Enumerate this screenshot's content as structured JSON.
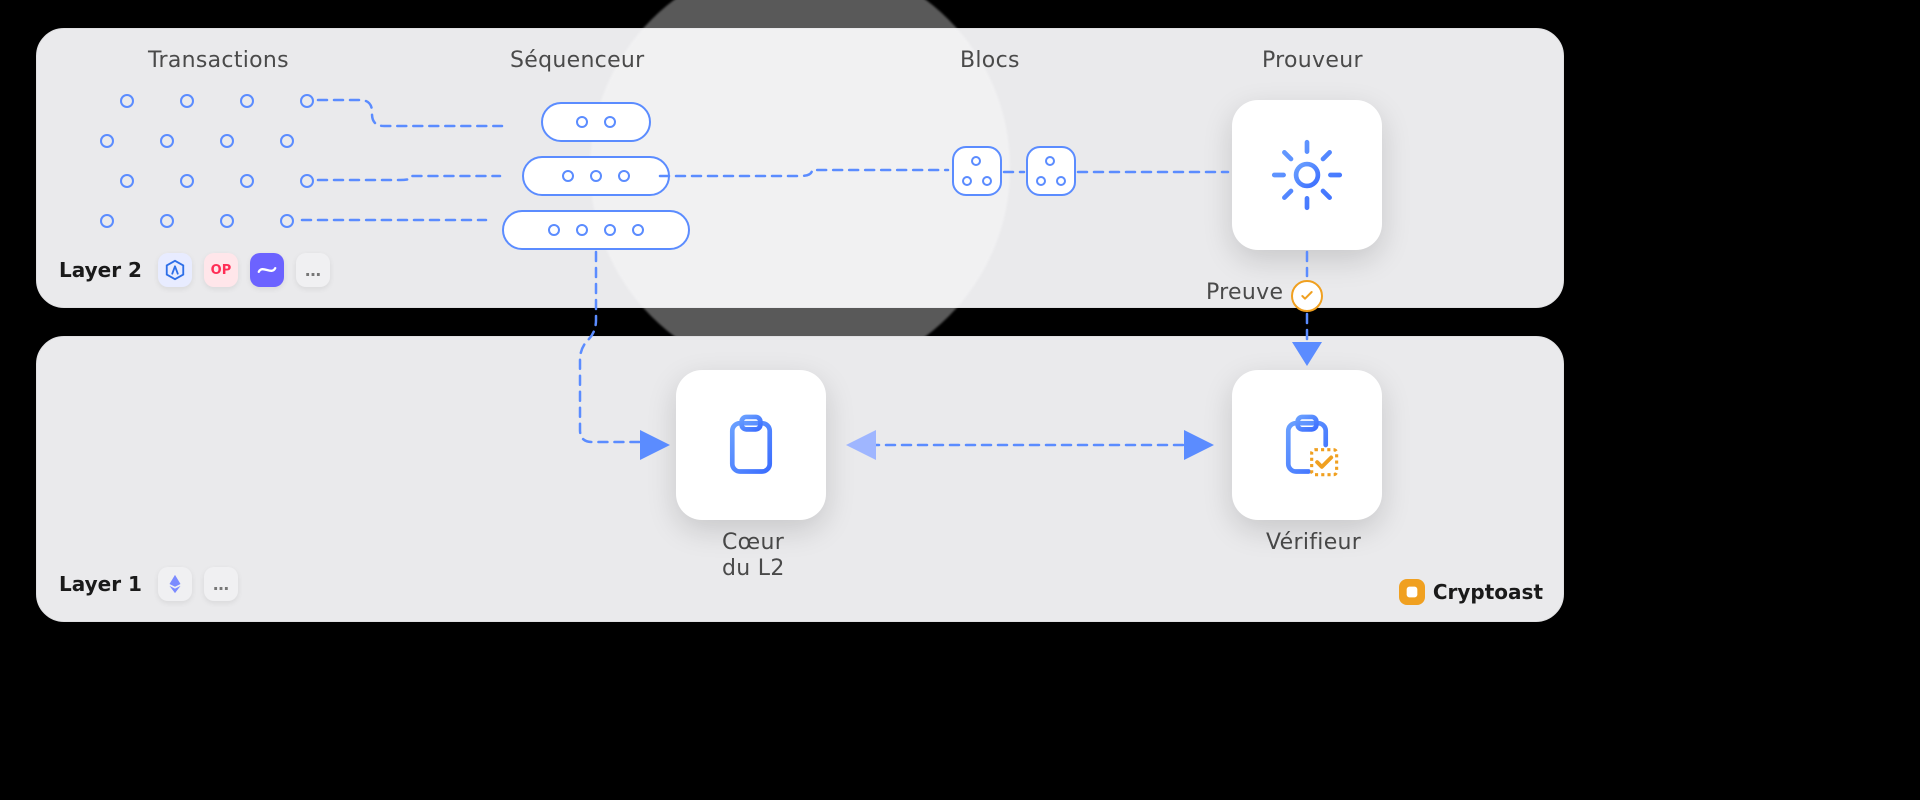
{
  "diagram": {
    "layers": {
      "l2": {
        "name": "Layer 2"
      },
      "l1": {
        "name": "Layer 1"
      }
    },
    "nodes": {
      "transactions": {
        "label": "Transactions"
      },
      "sequencer": {
        "label": "Séquenceur"
      },
      "blocks": {
        "label": "Blocs"
      },
      "prover": {
        "label": "Prouveur"
      },
      "proof": {
        "label": "Preuve"
      },
      "l2core": {
        "label_line1": "Cœur",
        "label_line2": "du L2"
      },
      "verifier": {
        "label": "Vérifieur"
      }
    },
    "l2_chains": [
      "arbitrum",
      "optimism",
      "starknet",
      "more"
    ],
    "l1_chains": [
      "ethereum",
      "more"
    ],
    "flow": [
      "transactions → sequencer",
      "sequencer → blocks",
      "blocks → prover",
      "prover → proof → verifier",
      "sequencer → l2core",
      "l2core ↔ verifier"
    ],
    "colors": {
      "blue": "#5b8cff",
      "orange": "#f0a020",
      "panel": "#eaeaec",
      "bg": "#000000"
    }
  },
  "brand": {
    "name": "Cryptoast"
  },
  "icons": {
    "arbitrum": "arbitrum-icon",
    "optimism": "OP",
    "starknet": "starknet-icon",
    "ethereum": "ethereum-icon",
    "more": "…",
    "gear": "gear-icon",
    "clipboard": "clipboard-icon",
    "clipboard_check": "clipboard-check-icon",
    "check": "check-icon"
  }
}
